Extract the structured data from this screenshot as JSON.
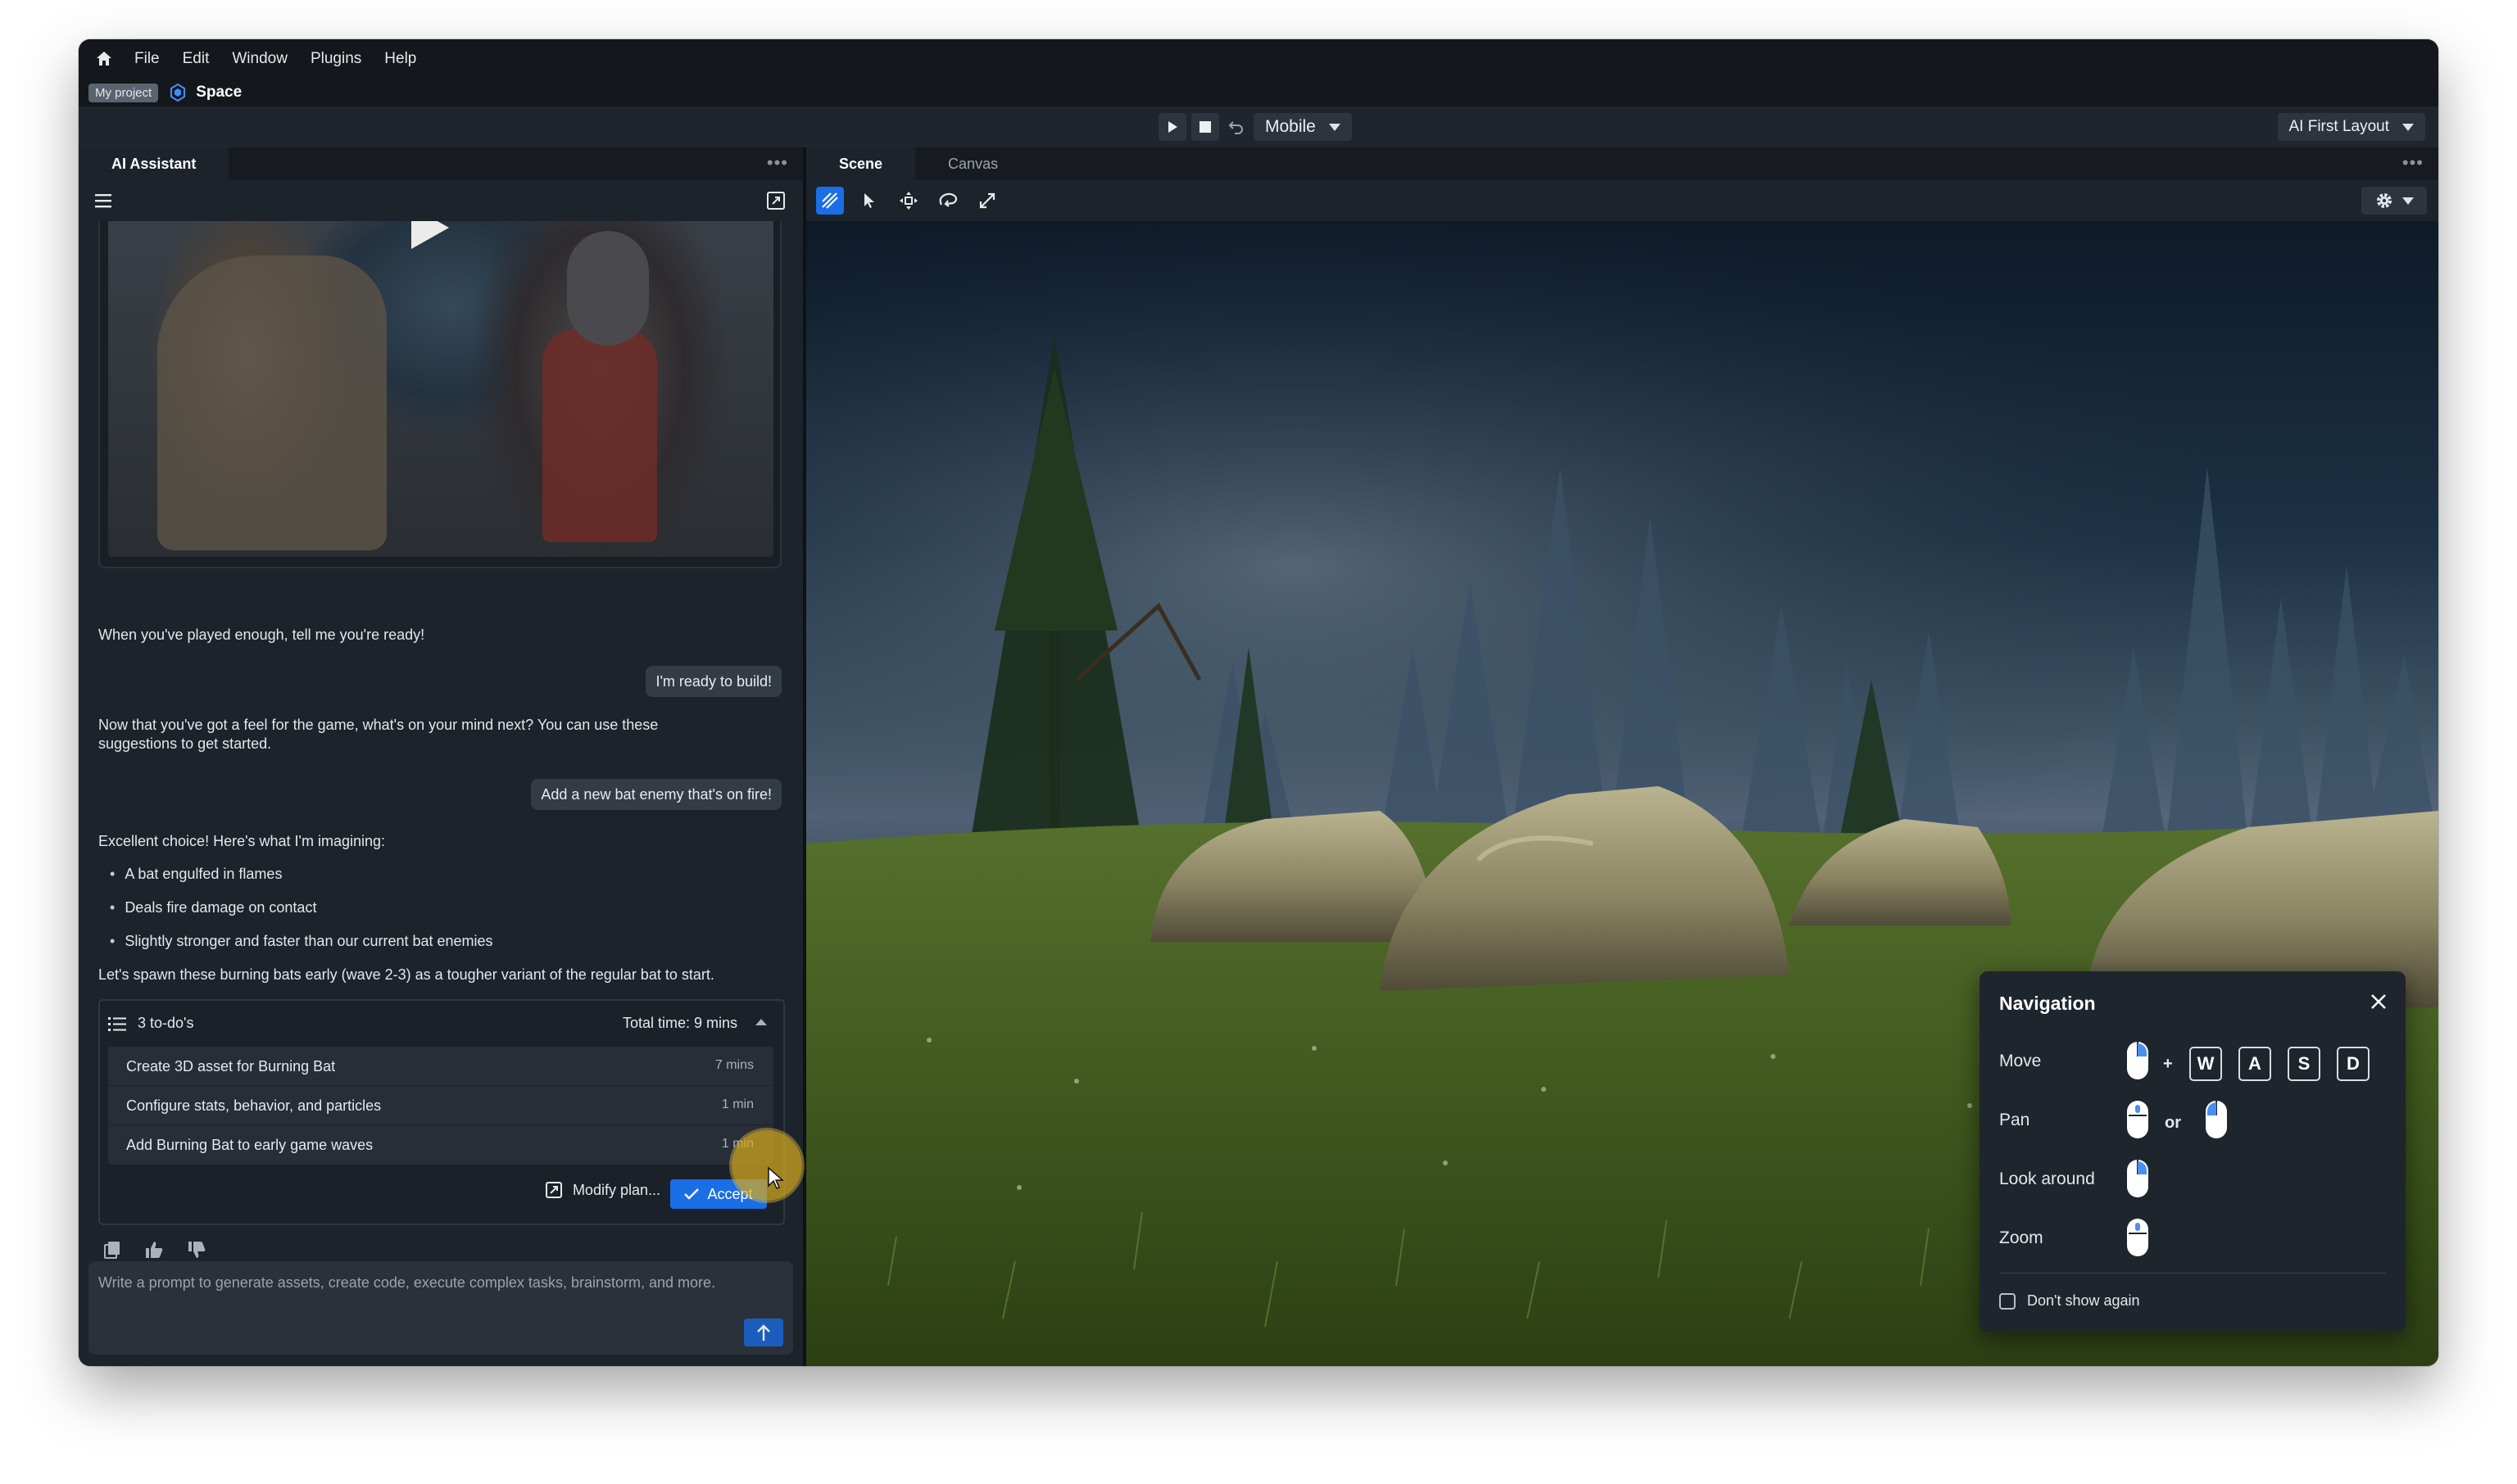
{
  "menu": {
    "items": [
      "File",
      "Edit",
      "Window",
      "Plugins",
      "Help"
    ]
  },
  "project": {
    "tag": "My project",
    "space": "Space"
  },
  "toolbar": {
    "platform": "Mobile",
    "layout": "AI First Layout"
  },
  "left_panel": {
    "tab": "AI Assistant",
    "messages": {
      "ai1": "When you've played enough, tell me you're ready!",
      "user1": "I'm ready to build!",
      "ai2": "Now that you've got a feel for the game, what's on your mind next? You can use these suggestions to get started.",
      "user2": "Add a new bat enemy that's on fire!",
      "ai3": "Excellent choice! Here's what I'm imagining:",
      "bullets": [
        "A bat engulfed in flames",
        "Deals fire damage on contact",
        "Slightly stronger and faster than our current bat enemies"
      ],
      "ai4": "Let's spawn these burning bats early (wave 2-3) as a tougher variant of the regular bat to start."
    },
    "plan": {
      "count": "3 to-do's",
      "total": "Total time: 9 mins",
      "tasks": [
        {
          "name": "Create 3D asset for Burning Bat",
          "duration": "7 mins"
        },
        {
          "name": "Configure stats, behavior, and particles",
          "duration": "1 min"
        },
        {
          "name": "Add Burning Bat to early game waves",
          "duration": "1 min"
        }
      ],
      "modify_label": "Modify plan...",
      "accept_label": "Accept"
    },
    "prompt_placeholder": "Write a prompt to generate assets, create code, execute complex tasks, brainstorm, and more."
  },
  "right_panel": {
    "tabs": [
      "Scene",
      "Canvas"
    ],
    "tools": [
      "move-tool-icon",
      "select-icon",
      "transform-icon",
      "rotate-icon",
      "scale-icon"
    ]
  },
  "navigation": {
    "title": "Navigation",
    "rows": {
      "move": "Move",
      "pan": "Pan",
      "look": "Look around",
      "zoom": "Zoom"
    },
    "keys": [
      "W",
      "A",
      "S",
      "D"
    ],
    "plus": "+",
    "or": "or",
    "dont_show": "Don't show again"
  },
  "colors": {
    "accent": "#1a6ee6",
    "panel": "#1d232b",
    "chrome": "#14171b"
  }
}
